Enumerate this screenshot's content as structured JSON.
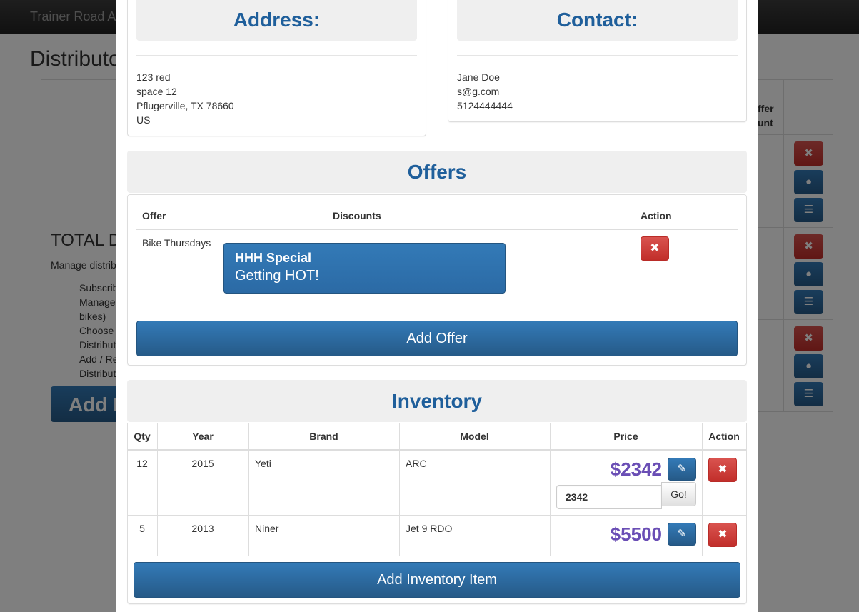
{
  "app": {
    "brand": "Trainer Road A",
    "page_title": "Distributo",
    "total_heading": "TOTAL D",
    "manage_text": "Manage distrib",
    "feature_list": [
      "Subscrib",
      "Manage",
      "bikes)",
      "Choose",
      "Distribut",
      "Add / Re",
      "Distribut"
    ],
    "add_button": "Add I",
    "column_header": "ffer\nunt",
    "row_buttons": [
      "✖",
      "👁",
      "☰"
    ]
  },
  "address": {
    "heading": "Address:",
    "lines": [
      "123 red",
      "space 12",
      "Pflugerville, TX 78660",
      "US"
    ]
  },
  "contact": {
    "heading": "Contact:",
    "lines": [
      "Jane Doe",
      "s@g.com",
      "5124444444"
    ]
  },
  "offers": {
    "heading": "Offers",
    "columns": [
      "Offer",
      "Discounts",
      "Action"
    ],
    "rows": [
      {
        "offer": "Bike Thursdays",
        "discount_name": "HHH Special",
        "discount_description": "Getting HOT!"
      }
    ],
    "add_button": "Add Offer"
  },
  "inventory": {
    "heading": "Inventory",
    "columns": [
      "Qty",
      "Year",
      "Brand",
      "Model",
      "Price",
      "Action"
    ],
    "rows": [
      {
        "qty": "12",
        "year": "2015",
        "brand": "Yeti",
        "model": "ARC",
        "price": "$2342",
        "edit_value": "2342",
        "go_label": "Go!"
      },
      {
        "qty": "5",
        "year": "2013",
        "brand": "Niner",
        "model": "Jet 9 RDO",
        "price": "$5500"
      }
    ],
    "add_button": "Add Inventory Item"
  },
  "icons": {
    "delete": "close-icon",
    "view": "eye-icon",
    "list": "list-icon",
    "edit": "pencil-icon"
  },
  "colors": {
    "heading_blue": "#1f5f9b",
    "primary": "#337ab7",
    "danger": "#d9534f",
    "price_purple": "#6a4eb5"
  }
}
